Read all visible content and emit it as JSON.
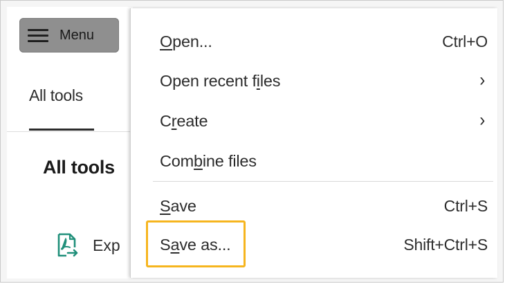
{
  "app": {
    "menu_button_label": "Menu",
    "tab_label": "All tools",
    "section_title": "All tools",
    "tool_partial_label": "Exp"
  },
  "menu": {
    "items": [
      {
        "pre": "",
        "u": "O",
        "post": "pen...",
        "shortcut": "Ctrl+O",
        "submenu": false
      },
      {
        "pre": "Open recent f",
        "u": "i",
        "post": "les",
        "shortcut": "",
        "submenu": true
      },
      {
        "pre": "C",
        "u": "r",
        "post": "eate",
        "shortcut": "",
        "submenu": true
      },
      {
        "pre": "Com",
        "u": "b",
        "post": "ine files",
        "shortcut": "",
        "submenu": false
      },
      {
        "pre": "",
        "u": "S",
        "post": "ave",
        "shortcut": "Ctrl+S",
        "submenu": false
      },
      {
        "pre": "S",
        "u": "a",
        "post": "ve as...",
        "shortcut": "Shift+Ctrl+S",
        "submenu": false
      }
    ],
    "submenu_glyph": "›"
  },
  "colors": {
    "highlight_border": "#f6b51e",
    "menu_button_bg": "#8f8f8f",
    "tool_icon": "#1f8f7a"
  },
  "icons": {
    "menu": "hamburger-icon",
    "tool": "pdf-export-icon",
    "submenu": "chevron-right-icon"
  }
}
